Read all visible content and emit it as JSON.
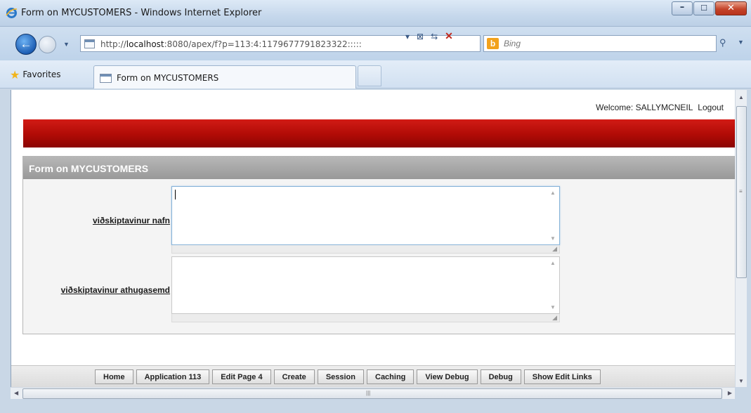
{
  "window": {
    "title": "Form on MYCUSTOMERS - Windows Internet Explorer"
  },
  "navigation": {
    "url_prefix": "http://",
    "url_host": "localhost",
    "url_rest": ":8080/apex/f?p=113:4:1179677791823322:::::",
    "search_placeholder": "Bing"
  },
  "favorites": {
    "label": "Favorites"
  },
  "tabs": [
    {
      "label": "Form on MYCUSTOMERS"
    }
  ],
  "page": {
    "welcome_label": "Welcome: SALLYMCNEIL",
    "logout_label": "Logout",
    "accent_color": "#b00b06",
    "region_title": "Form on MYCUSTOMERS",
    "fields": [
      {
        "label": "viðskiptavinur nafn",
        "value": ""
      },
      {
        "label": "viðskiptavinur athugasemd",
        "value": ""
      }
    ]
  },
  "dev_toolbar": [
    "Home",
    "Application 113",
    "Edit Page 4",
    "Create",
    "Session",
    "Caching",
    "View Debug",
    "Debug",
    "Show Edit Links"
  ]
}
